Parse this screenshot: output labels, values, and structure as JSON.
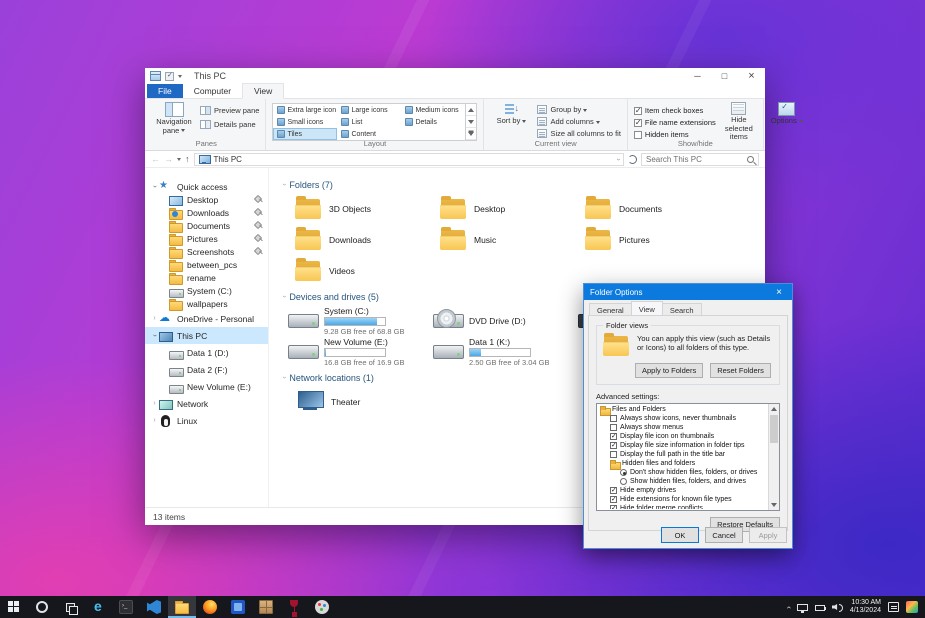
{
  "colors": {
    "accent_blue": "#0b79dd",
    "selection_blue": "#cce8ff",
    "file_tab_blue": "#1f68c3",
    "drive_bar_fill": "#49a8e8",
    "folder_yellow": "#f8c654"
  },
  "titlebar": {
    "title": "This PC"
  },
  "ribbon": {
    "tabs": [
      {
        "label": "File",
        "kind": "file"
      },
      {
        "label": "Computer",
        "kind": "plain"
      },
      {
        "label": "View",
        "kind": "active"
      }
    ],
    "panes": {
      "group_label": "Panes",
      "navigation": "Navigation pane",
      "preview": "Preview pane",
      "details": "Details pane"
    },
    "layout": {
      "group_label": "Layout",
      "items": [
        {
          "label": "Extra large icons"
        },
        {
          "label": "Large icons"
        },
        {
          "label": "Medium icons"
        },
        {
          "label": "Small icons"
        },
        {
          "label": "List"
        },
        {
          "label": "Details"
        },
        {
          "label": "Tiles",
          "selected": true
        },
        {
          "label": "Content"
        }
      ]
    },
    "current_view": {
      "group_label": "Current view",
      "sort_by": "Sort by",
      "group_by": "Group by",
      "add_columns": "Add columns",
      "size_columns": "Size all columns to fit"
    },
    "show_hide": {
      "group_label": "Show/hide",
      "checkboxes": [
        {
          "label": "Item check boxes",
          "checked": true
        },
        {
          "label": "File name extensions",
          "checked": true
        },
        {
          "label": "Hidden items",
          "checked": false
        }
      ],
      "hide_selected": "Hide selected items"
    },
    "options_label": "Options"
  },
  "address_bar": {
    "location": "This PC",
    "search_placeholder": "Search This PC"
  },
  "sidebar": {
    "items": [
      {
        "label": "Quick access",
        "icon": "star",
        "level": 0,
        "chev": "expanded"
      },
      {
        "label": "Desktop",
        "icon": "monitor",
        "level": 1,
        "pin": true
      },
      {
        "label": "Downloads",
        "icon": "folder-down",
        "level": 1,
        "pin": true
      },
      {
        "label": "Documents",
        "icon": "folder",
        "level": 1,
        "pin": true
      },
      {
        "label": "Pictures",
        "icon": "folder",
        "level": 1,
        "pin": true
      },
      {
        "label": "Screenshots",
        "icon": "folder",
        "level": 1,
        "pin": true
      },
      {
        "label": "between_pcs",
        "icon": "folder",
        "level": 1
      },
      {
        "label": "rename",
        "icon": "folder",
        "level": 1
      },
      {
        "label": "System (C:)",
        "icon": "drive",
        "level": 1
      },
      {
        "label": "wallpapers",
        "icon": "folder",
        "level": 1
      },
      {
        "label": "OneDrive - Personal",
        "icon": "cloud",
        "level": 0,
        "chev": "collapsed",
        "tall": true
      },
      {
        "label": "This PC",
        "icon": "pc",
        "level": 0,
        "chev": "expanded",
        "selected": true,
        "tall": true
      },
      {
        "label": "Data 1 (D:)",
        "icon": "drive",
        "level": 1,
        "tall": true
      },
      {
        "label": "Data 2 (F:)",
        "icon": "drive",
        "level": 1,
        "tall": true
      },
      {
        "label": "New Volume (E:)",
        "icon": "drive",
        "level": 1,
        "tall": true
      },
      {
        "label": "Network",
        "icon": "network",
        "level": 0,
        "chev": "collapsed",
        "tall": true
      },
      {
        "label": "Linux",
        "icon": "penguin",
        "level": 0,
        "chev": "collapsed",
        "tall": true
      }
    ]
  },
  "content": {
    "folders": {
      "header": "Folders (7)",
      "items": [
        "3D Objects",
        "Desktop",
        "Documents",
        "Downloads",
        "Music",
        "Pictures",
        "Videos"
      ]
    },
    "drives": {
      "header": "Devices and drives (5)",
      "items": [
        {
          "name": "System (C:)",
          "detail": "9.28 GB free of 68.8 GB",
          "used_percent": 86,
          "bar": "width:86%",
          "type": "hdd"
        },
        {
          "name": "DVD Drive (D:)",
          "detail": "",
          "type": "dvd"
        },
        {
          "name": "",
          "detail": "",
          "type": "hidden"
        },
        {
          "name": "New Volume (E:)",
          "detail": "16.8 GB free of 16.9 GB",
          "used_percent": 1,
          "bar": "width:2%",
          "type": "hdd"
        },
        {
          "name": "Data 1 (K:)",
          "detail": "2.50 GB free of 3.04 GB",
          "used_percent": 18,
          "bar": "width:18%",
          "type": "hdd"
        }
      ]
    },
    "network": {
      "header": "Network locations (1)",
      "items": [
        {
          "name": "Theater"
        }
      ]
    }
  },
  "status_bar": {
    "items_count": "13 items"
  },
  "dialog": {
    "title": "Folder Options",
    "tabs": [
      {
        "label": "General"
      },
      {
        "label": "View",
        "active": true
      },
      {
        "label": "Search"
      }
    ],
    "folder_views": {
      "group_label": "Folder views",
      "description": "You can apply this view (such as Details or Icons) to all folders of this type.",
      "apply_button": "Apply to Folders",
      "reset_button": "Reset Folders"
    },
    "advanced_label": "Advanced settings:",
    "settings": [
      {
        "type": "group",
        "label": "Files and Folders"
      },
      {
        "type": "checkbox",
        "label": "Always show icons, never thumbnails",
        "checked": false
      },
      {
        "type": "checkbox",
        "label": "Always show menus",
        "checked": false
      },
      {
        "type": "checkbox",
        "label": "Display file icon on thumbnails",
        "checked": true
      },
      {
        "type": "checkbox",
        "label": "Display file size information in folder tips",
        "checked": true
      },
      {
        "type": "checkbox",
        "label": "Display the full path in the title bar",
        "checked": false
      },
      {
        "type": "subgroup",
        "label": "Hidden files and folders"
      },
      {
        "type": "radio",
        "label": "Don't show hidden files, folders, or drives",
        "checked": true
      },
      {
        "type": "radio",
        "label": "Show hidden files, folders, and drives",
        "checked": false
      },
      {
        "type": "checkbox",
        "label": "Hide empty drives",
        "checked": true
      },
      {
        "type": "checkbox",
        "label": "Hide extensions for known file types",
        "checked": true
      },
      {
        "type": "checkbox",
        "label": "Hide folder merge conflicts",
        "checked": true
      }
    ],
    "restore_button": "Restore Defaults",
    "ok_button": "OK",
    "cancel_button": "Cancel",
    "apply_button": "Apply"
  },
  "taskbar": {
    "apps": [
      {
        "icon": "settings-gear"
      },
      {
        "icon": "task-view"
      },
      {
        "icon": "edge"
      },
      {
        "icon": "terminal"
      },
      {
        "icon": "vscode"
      },
      {
        "icon": "file-explorer",
        "active": true
      },
      {
        "icon": "firefox"
      },
      {
        "icon": "photos"
      },
      {
        "icon": "package"
      },
      {
        "icon": "wine"
      },
      {
        "icon": "paint"
      }
    ],
    "clock": {
      "time": "10:30 AM",
      "date": "4/13/2024"
    }
  }
}
